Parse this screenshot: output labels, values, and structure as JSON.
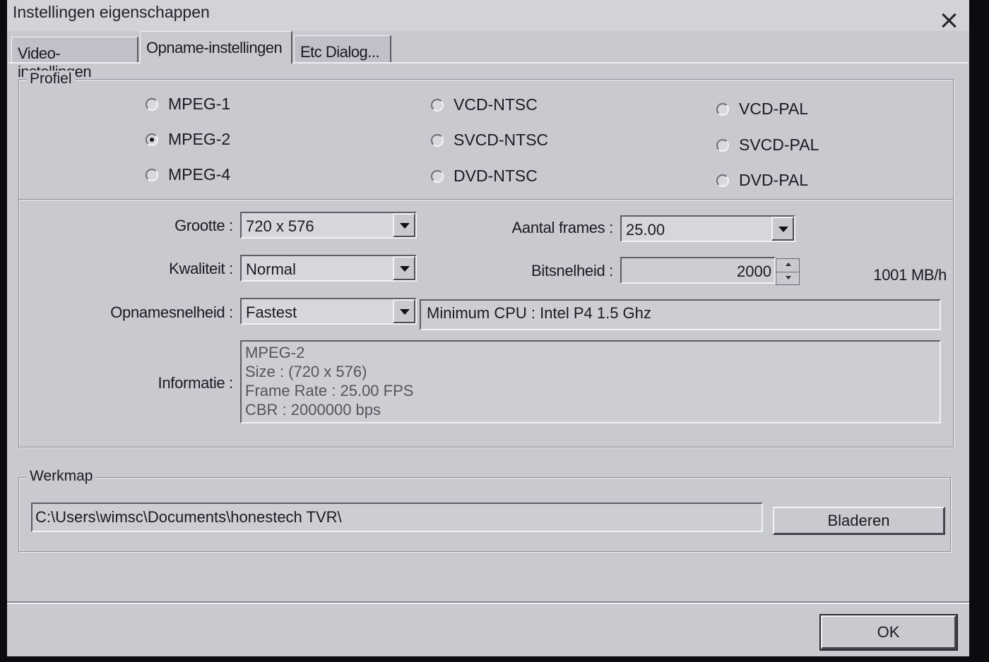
{
  "window": {
    "title": "Instellingen eigenschappen"
  },
  "tabs": [
    {
      "label": "Video-instellingen"
    },
    {
      "label": "Opname-instellingen"
    },
    {
      "label": "Etc Dialog..."
    }
  ],
  "profile": {
    "legend": "Profiel",
    "options": [
      {
        "label": "MPEG-1"
      },
      {
        "label": "MPEG-2"
      },
      {
        "label": "MPEG-4"
      },
      {
        "label": "VCD-NTSC"
      },
      {
        "label": "SVCD-NTSC"
      },
      {
        "label": "DVD-NTSC"
      },
      {
        "label": "VCD-PAL"
      },
      {
        "label": "SVCD-PAL"
      },
      {
        "label": "DVD-PAL"
      }
    ],
    "selected": "MPEG-2"
  },
  "settings": {
    "size_label": "Grootte :",
    "size_value": "720 x 576",
    "frames_label": "Aantal frames :",
    "frames_value": "25.00",
    "quality_label": "Kwaliteit :",
    "quality_value": "Normal",
    "bitrate_label": "Bitsnelheid :",
    "bitrate_value": "2000",
    "rate_per_hour": "1001 MB/h",
    "speed_label": "Opnamesnelheid :",
    "speed_value": "Fastest",
    "min_cpu": "Minimum CPU : Intel P4 1.5 Ghz",
    "info_label": "Informatie :",
    "info_lines": [
      "MPEG-2",
      "Size : (720 x 576)",
      "Frame Rate : 25.00 FPS",
      "CBR : 2000000 bps"
    ]
  },
  "workdir": {
    "legend": "Werkmap",
    "path": "C:\\Users\\wimsc\\Documents\\honestech TVR\\",
    "browse_label": "Bladeren"
  },
  "footer": {
    "ok_label": "OK"
  }
}
